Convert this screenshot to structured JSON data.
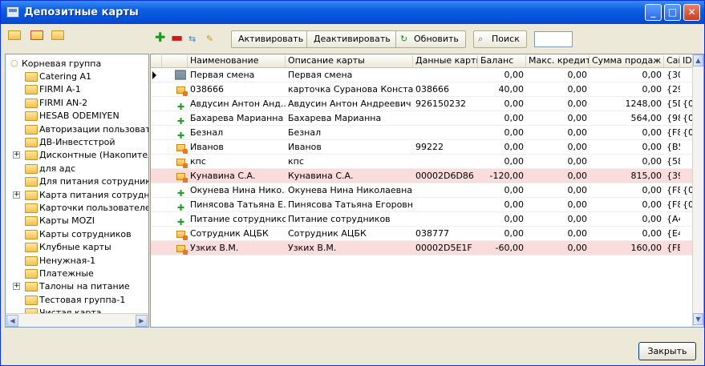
{
  "window": {
    "title": "Депозитные карты",
    "minimize_icon": "minimize-icon",
    "maximize_icon": "maximize-icon",
    "close_icon": "close-icon"
  },
  "toolbar": {
    "activate_label": "Активировать",
    "deactivate_label": "Деактивировать",
    "refresh_label": "Обновить",
    "search_label": "Поиск",
    "search_value": ""
  },
  "tree": {
    "root": "Корневая группа",
    "items": [
      {
        "label": "Catering A1",
        "expandable": false
      },
      {
        "label": "FIRMI A-1",
        "expandable": false
      },
      {
        "label": "FIRMI AN-2",
        "expandable": false
      },
      {
        "label": "HESAB ODEMIYEN",
        "expandable": false
      },
      {
        "label": "Авторизации пользовате",
        "expandable": false
      },
      {
        "label": "ДВ-Инвестстрой",
        "expandable": false
      },
      {
        "label": "Дисконтные (Накопител",
        "expandable": true
      },
      {
        "label": "для адс",
        "expandable": false
      },
      {
        "label": "Для питания сотруднико",
        "expandable": false
      },
      {
        "label": "Карта питания сотрудни",
        "expandable": true
      },
      {
        "label": "Карточки пользователей",
        "expandable": false
      },
      {
        "label": "Карты MOZI",
        "expandable": false
      },
      {
        "label": "Карты сотрудников",
        "expandable": false
      },
      {
        "label": "Клубные карты",
        "expandable": false
      },
      {
        "label": "Ненужная-1",
        "expandable": false
      },
      {
        "label": "Платежные",
        "expandable": false
      },
      {
        "label": "Талоны на питание",
        "expandable": true
      },
      {
        "label": "Тестовая группа-1",
        "expandable": false
      },
      {
        "label": "Чистая карта",
        "expandable": false
      }
    ]
  },
  "grid": {
    "columns": [
      "Наименование",
      "Описание карты",
      "Данные карты",
      "Баланс",
      "Макс. кредит",
      "Сумма продаж",
      "CardID",
      "ID м"
    ],
    "rows": [
      {
        "icon": "folder",
        "name": "Первая смена",
        "desc": "Первая смена",
        "data": "",
        "balance": "0,00",
        "credit": "0,00",
        "sales": "0,00",
        "cardid": "{30...",
        "id": "",
        "highlight": false,
        "current": true
      },
      {
        "icon": "card",
        "name": "038666",
        "desc": "карточка Суранова Конста...",
        "data": "038666",
        "balance": "40,00",
        "credit": "0,00",
        "sales": "0,00",
        "cardid": "{29...",
        "id": "",
        "highlight": false,
        "current": false
      },
      {
        "icon": "plus",
        "name": "Авдусин Антон Анд...",
        "desc": "Авдусин Антон Андреевич",
        "data": "926150232",
        "balance": "0,00",
        "credit": "0,00",
        "sales": "1248,00",
        "cardid": "{5D...",
        "id": "{0...",
        "highlight": false,
        "current": false
      },
      {
        "icon": "plus",
        "name": "Бахарева Марианна",
        "desc": "Бахарева Марианна",
        "data": "",
        "balance": "0,00",
        "credit": "0,00",
        "sales": "564,00",
        "cardid": "{98...",
        "id": "{0...",
        "highlight": false,
        "current": false
      },
      {
        "icon": "plus",
        "name": "Безнал",
        "desc": "Безнал",
        "data": "",
        "balance": "0,00",
        "credit": "0,00",
        "sales": "0,00",
        "cardid": "{F8...",
        "id": "{0...",
        "highlight": false,
        "current": false
      },
      {
        "icon": "card",
        "name": "Иванов",
        "desc": "Иванов",
        "data": "99222",
        "balance": "0,00",
        "credit": "0,00",
        "sales": "0,00",
        "cardid": "{B5...",
        "id": "",
        "highlight": false,
        "current": false
      },
      {
        "icon": "card",
        "name": "кпс",
        "desc": "кпс",
        "data": "",
        "balance": "0,00",
        "credit": "0,00",
        "sales": "0,00",
        "cardid": "{58...",
        "id": "",
        "highlight": false,
        "current": false
      },
      {
        "icon": "card",
        "name": "Кунавина С.А.",
        "desc": "Кунавина С.А.",
        "data": "00002D6D86",
        "balance": "-120,00",
        "credit": "0,00",
        "sales": "815,00",
        "cardid": "{39...",
        "id": "",
        "highlight": true,
        "current": false
      },
      {
        "icon": "plus",
        "name": "Окунева Нина Нико...",
        "desc": "Окунева Нина Николаевна",
        "data": "",
        "balance": "0,00",
        "credit": "0,00",
        "sales": "0,00",
        "cardid": "{F8...",
        "id": "{0...",
        "highlight": false,
        "current": false
      },
      {
        "icon": "plus",
        "name": "Пинясова Татьяна Е...",
        "desc": "Пинясова Татьяна Егоровна",
        "data": "",
        "balance": "0,00",
        "credit": "0,00",
        "sales": "0,00",
        "cardid": "{F8...",
        "id": "{0...",
        "highlight": false,
        "current": false
      },
      {
        "icon": "plus",
        "name": "Питание сотрудников",
        "desc": "Питание сотрудников",
        "data": "",
        "balance": "0,00",
        "credit": "0,00",
        "sales": "0,00",
        "cardid": "{A4...",
        "id": "",
        "highlight": false,
        "current": false
      },
      {
        "icon": "card",
        "name": "Сотрудник АЦБК",
        "desc": "Сотрудник АЦБК",
        "data": "038777",
        "balance": "0,00",
        "credit": "0,00",
        "sales": "0,00",
        "cardid": "{E4...",
        "id": "",
        "highlight": false,
        "current": false
      },
      {
        "icon": "card",
        "name": "Узких В.М.",
        "desc": "Узких В.М.",
        "data": "00002D5E1F",
        "balance": "-60,00",
        "credit": "0,00",
        "sales": "160,00",
        "cardid": "{FE...",
        "id": "",
        "highlight": true,
        "current": false
      }
    ]
  },
  "footer": {
    "close_label": "Закрыть"
  }
}
